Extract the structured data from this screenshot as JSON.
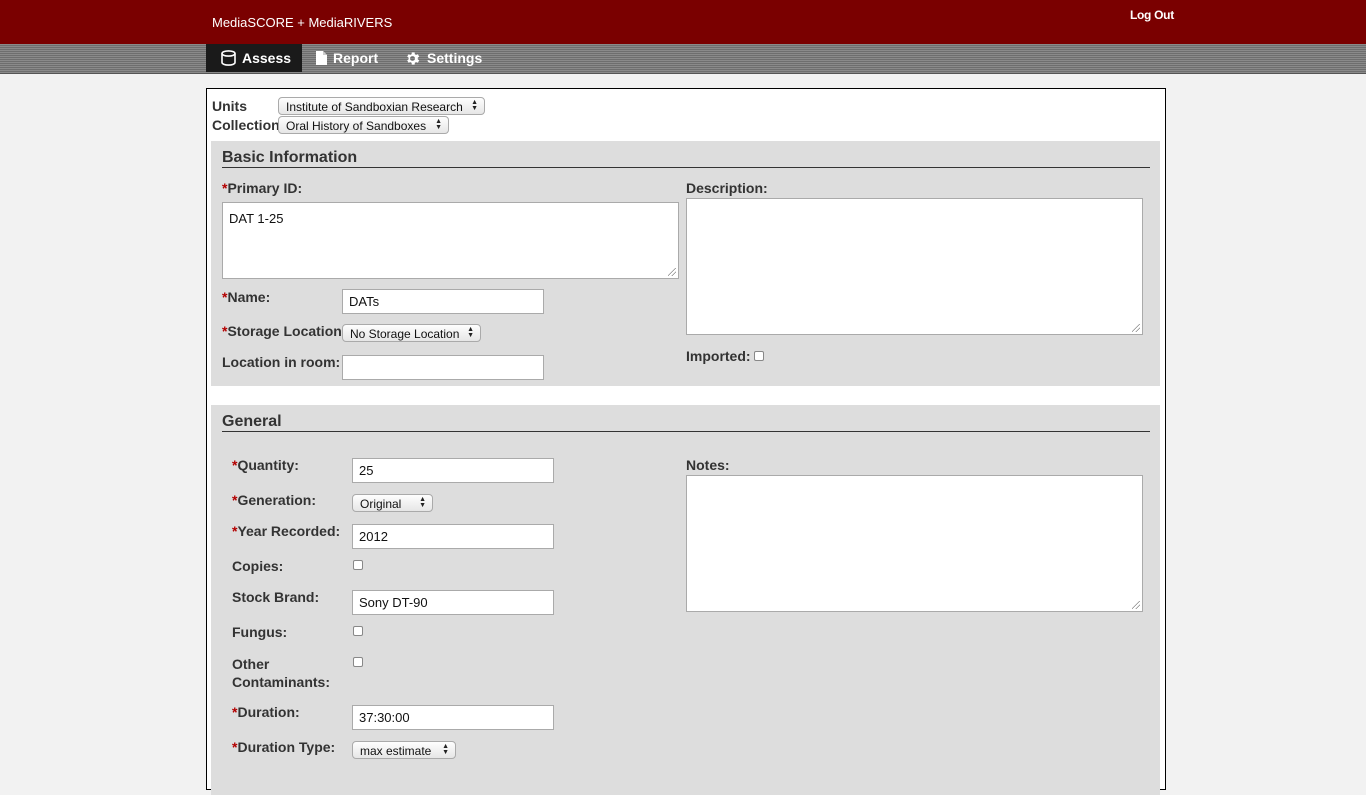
{
  "header": {
    "app_title": "MediaSCORE + MediaRIVERS",
    "logout_label": "Log Out"
  },
  "nav": {
    "tabs": [
      {
        "label": "Assess",
        "icon": "database-icon",
        "active": true
      },
      {
        "label": "Report",
        "icon": "document-icon",
        "active": false
      },
      {
        "label": "Settings",
        "icon": "gear-icon",
        "active": false
      }
    ]
  },
  "filters": {
    "units_label": "Units",
    "units_value": "Institute of Sandboxian Research",
    "collection_label": "Collection",
    "collection_value": "Oral History of Sandboxes"
  },
  "basic_info": {
    "title": "Basic Information",
    "required_mark": "*",
    "primary_id_label": "Primary ID:",
    "primary_id_value": "DAT 1-25",
    "name_label": "Name:",
    "name_value": "DATs",
    "storage_label": "Storage Location:",
    "storage_value": "No Storage Location",
    "location_room_label": "Location in room:",
    "location_room_value": "",
    "description_label": "Description:",
    "description_value": "",
    "imported_label": "Imported:"
  },
  "general": {
    "title": "General",
    "quantity_label": "Quantity:",
    "quantity_value": "25",
    "generation_label": "Generation:",
    "generation_value": "Original",
    "year_label": "Year Recorded:",
    "year_value": "2012",
    "copies_label": "Copies:",
    "stock_brand_label": "Stock Brand:",
    "stock_brand_value": "Sony DT-90",
    "fungus_label": "Fungus:",
    "other_contaminants_label_1": "Other",
    "other_contaminants_label_2": "Contaminants:",
    "duration_label": "Duration:",
    "duration_value": "37:30:00",
    "duration_type_label": "Duration Type:",
    "duration_type_value": "max estimate",
    "notes_label": "Notes:",
    "notes_value": ""
  },
  "colors": {
    "brand": "#7a0000",
    "section_bg": "#dddddd",
    "required": "#b30000"
  }
}
